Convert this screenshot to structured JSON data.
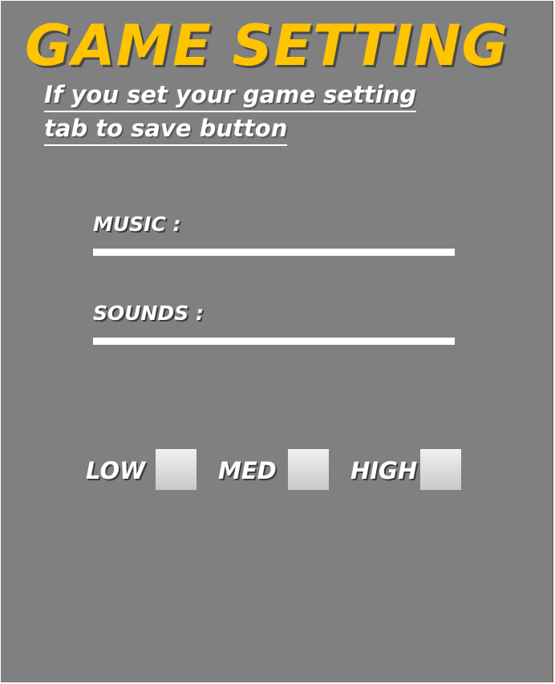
{
  "title": "GAME SETTING",
  "subtitle": {
    "line1": "If you set your game setting",
    "line2": "tab to save button"
  },
  "audio": {
    "music_label": "MUSIC :",
    "music_level": 1.0,
    "sounds_label": "SOUNDS :",
    "sounds_level": 1.0
  },
  "quality": {
    "low_label": "LOW",
    "med_label": "MED",
    "high_label": "HIGH",
    "low_checked": false,
    "med_checked": false,
    "high_checked": false
  },
  "colors": {
    "background": "#808080",
    "title": "#ffc400",
    "text": "#ffffff"
  }
}
